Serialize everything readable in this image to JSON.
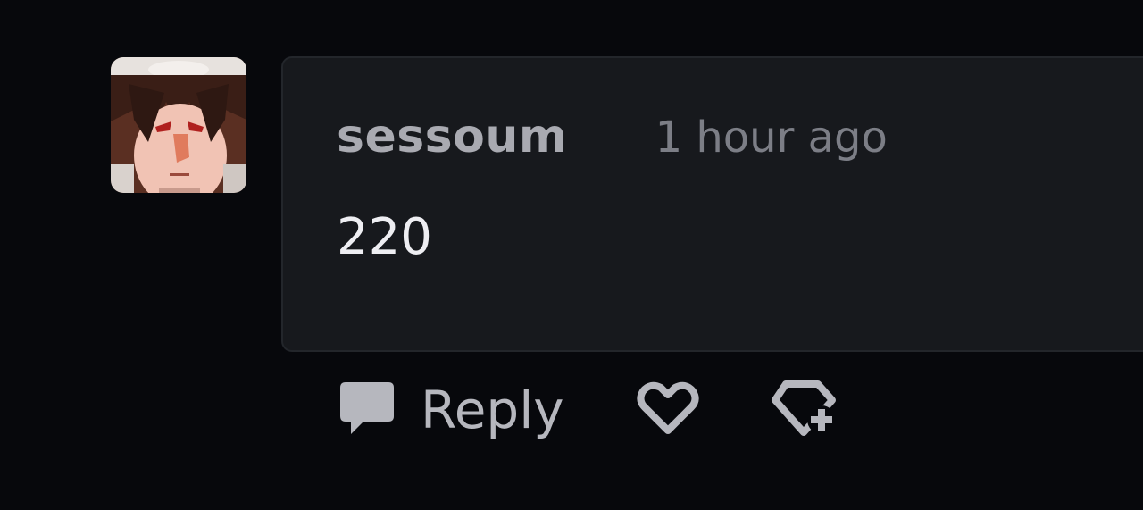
{
  "comment": {
    "author": "sessoum",
    "timestamp": "1 hour ago",
    "text": "220"
  },
  "actions": {
    "reply_label": "Reply",
    "reply_icon": "comment-bubble-icon",
    "like_icon": "heart-icon",
    "award_icon": "award-plus-icon"
  },
  "colors": {
    "background": "#07080c",
    "bubble": "#17191d",
    "username": "#a9aab1",
    "timestamp": "#7c7e86",
    "text": "#eeeef2",
    "icon": "#b6b7be"
  }
}
